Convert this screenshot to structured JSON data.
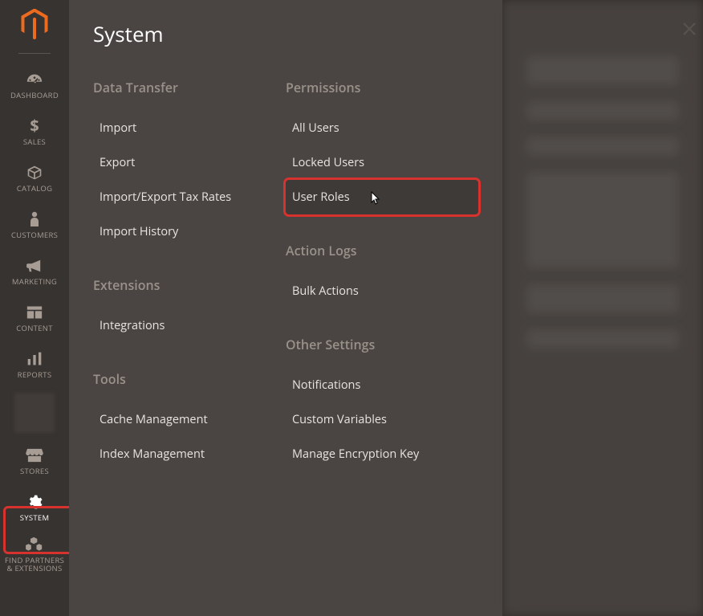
{
  "sidebar": {
    "items": [
      {
        "label": "DASHBOARD",
        "icon": "gauge"
      },
      {
        "label": "SALES",
        "icon": "dollar"
      },
      {
        "label": "CATALOG",
        "icon": "box"
      },
      {
        "label": "CUSTOMERS",
        "icon": "person"
      },
      {
        "label": "MARKETING",
        "icon": "megaphone"
      },
      {
        "label": "CONTENT",
        "icon": "layout"
      },
      {
        "label": "REPORTS",
        "icon": "bars"
      }
    ],
    "items_lower": [
      {
        "label": "STORES",
        "icon": "storefront"
      },
      {
        "label": "SYSTEM",
        "icon": "gear",
        "active": true
      },
      {
        "label": "FIND PARTNERS & EXTENSIONS",
        "icon": "cubes"
      }
    ]
  },
  "flyout": {
    "title": "System",
    "columns": [
      {
        "sections": [
          {
            "title": "Data Transfer",
            "links": [
              "Import",
              "Export",
              "Import/Export Tax Rates",
              "Import History"
            ]
          },
          {
            "title": "Extensions",
            "links": [
              "Integrations"
            ]
          },
          {
            "title": "Tools",
            "links": [
              "Cache Management",
              "Index Management"
            ]
          }
        ]
      },
      {
        "sections": [
          {
            "title": "Permissions",
            "links": [
              "All Users",
              "Locked Users",
              "User Roles"
            ],
            "highlight": 2
          },
          {
            "title": "Action Logs",
            "links": [
              "Bulk Actions"
            ]
          },
          {
            "title": "Other Settings",
            "links": [
              "Notifications",
              "Custom Variables",
              "Manage Encryption Key"
            ]
          }
        ]
      }
    ]
  }
}
